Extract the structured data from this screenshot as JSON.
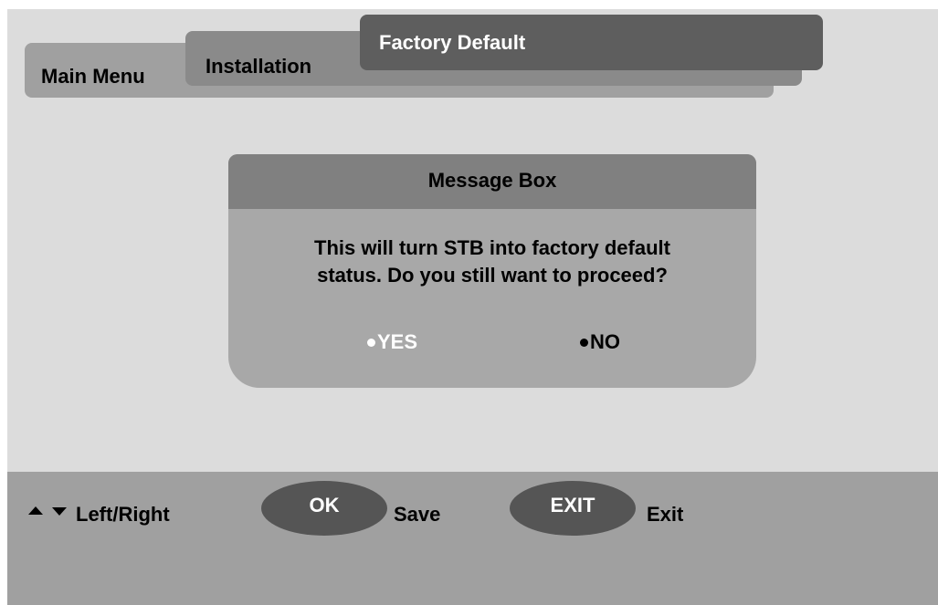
{
  "breadcrumb": {
    "main_menu": "Main Menu",
    "installation": "Installation",
    "factory_default": "Factory Default"
  },
  "dialog": {
    "title": "Message Box",
    "message_line1": "This will turn STB into factory default",
    "message_line2": "status. Do you still want to proceed?",
    "yes_label": "YES",
    "no_label": "NO",
    "selected_option": "YES"
  },
  "help": {
    "nav_icons": [
      "up-arrow",
      "down-arrow"
    ],
    "nav_label": "Left/Right",
    "ok_key": "OK",
    "ok_label": "Save",
    "exit_key": "EXIT",
    "exit_label": "Exit"
  },
  "colors": {
    "background": "#dcdcdc",
    "active_tab": "#5e5e5e",
    "dialog_body": "#a8a8a8",
    "dialog_header": "#808080",
    "key_button": "#555555",
    "selected_text": "#ffffff"
  }
}
